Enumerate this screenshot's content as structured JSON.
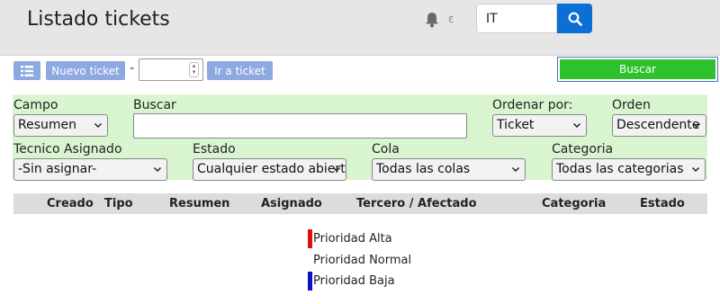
{
  "header": {
    "title": "Listado tickets",
    "notification_count": "ε",
    "search_value": "IT"
  },
  "toolbar": {
    "nuevo_label": "Nuevo ticket",
    "dash": "-",
    "ir_label": "Ir a ticket",
    "buscar_label": "Buscar"
  },
  "filters": {
    "campo_label": "Campo",
    "campo_value": "Resumen",
    "buscar_label": "Buscar",
    "buscar_value": "",
    "ordenar_label": "Ordenar por:",
    "ordenar_value": "Ticket",
    "orden_label": "Orden",
    "orden_value": "Descendente",
    "tecnico_label": "Tecnico Asignado",
    "tecnico_value": "-Sin asignar-",
    "estado_label": "Estado",
    "estado_value": "Cualquier estado abiert",
    "cola_label": "Cola",
    "cola_value": "Todas las colas",
    "categoria_label": "Categoria",
    "categoria_value": "Todas las categorias"
  },
  "table": {
    "columns": [
      "Creado",
      "Tipo",
      "Resumen",
      "Asignado",
      "Tercero / Afectado",
      "Categoria",
      "Estado"
    ]
  },
  "legend": [
    {
      "label": "Prioridad Alta",
      "color": "#e01010"
    },
    {
      "label": "Prioridad Normal",
      "color": "#ffffff"
    },
    {
      "label": "Prioridad Baja",
      "color": "#1010c0"
    }
  ]
}
